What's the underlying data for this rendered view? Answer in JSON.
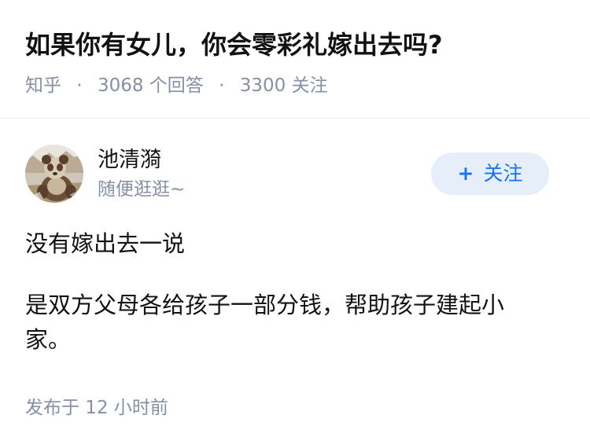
{
  "question": {
    "title": "如果你有女儿，你会零彩礼嫁出去吗?",
    "source": "知乎",
    "separator": "·",
    "answers": "3068 个回答",
    "followers": "3300 关注"
  },
  "author": {
    "name": "池清漪",
    "bio": "随便逛逛~",
    "follow_icon": "plus-icon",
    "follow_plus": "+",
    "follow_label": "关注",
    "follow_color": "#1772f6",
    "follow_bg": "#e5eef9"
  },
  "answer": {
    "paragraphs": [
      "没有嫁出去一说",
      "是双方父母各给孩子一部分钱，帮助孩子建起小家。"
    ],
    "published": "发布于 12 小时前"
  },
  "colors": {
    "text": "#121212",
    "meta": "#8590a6",
    "divider": "#ebebeb"
  }
}
